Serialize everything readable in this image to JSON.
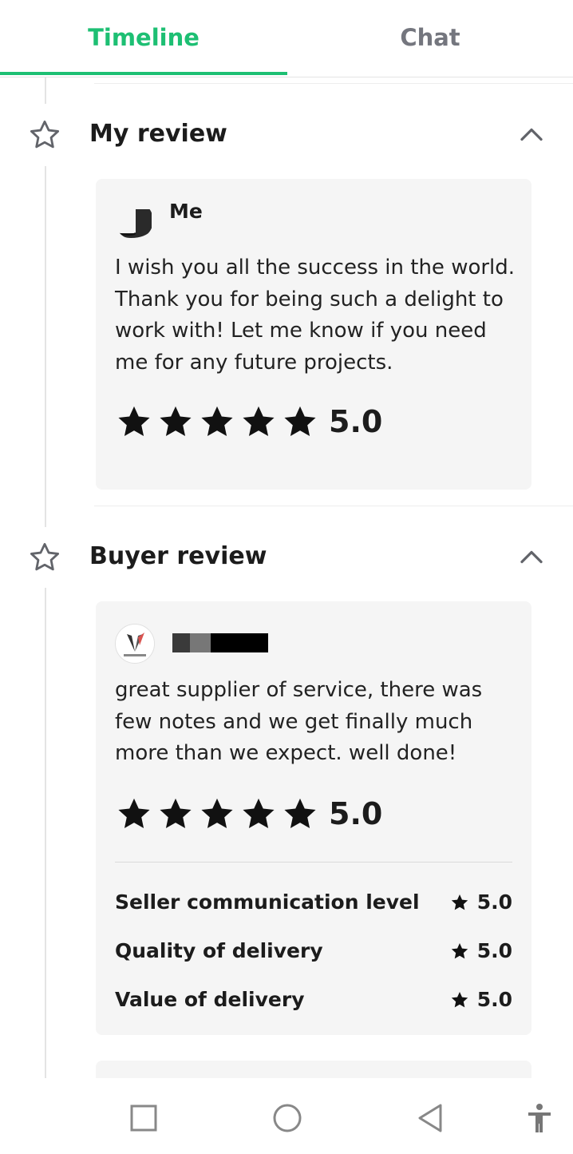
{
  "tabs": [
    {
      "label": "Timeline",
      "active": true
    },
    {
      "label": "Chat",
      "active": false
    }
  ],
  "colors": {
    "accent": "#1dbf73",
    "inactive_tab": "#74767e",
    "card_bg": "#f5f5f5"
  },
  "my_review": {
    "title": "My review",
    "author": "Me",
    "text": "I wish you all the success in the world. Thank you for being such a delight to work with! Let me know if you need me for any future projects.",
    "rating": "5.0",
    "stars": 5
  },
  "buyer_review": {
    "title": "Buyer review",
    "author": "",
    "text": "great supplier of service, there was few notes and we get finally much more than we expect. well done!",
    "rating": "5.0",
    "stars": 5,
    "sub_ratings": [
      {
        "label": "Seller communication level",
        "score": "5.0"
      },
      {
        "label": "Quality of delivery",
        "score": "5.0"
      },
      {
        "label": "Value of delivery",
        "score": "5.0"
      }
    ]
  },
  "icons": {
    "section": "star-outline-icon",
    "collapse": "chevron-up-icon",
    "nav": [
      "recent-apps-icon",
      "home-icon",
      "back-icon",
      "accessibility-icon"
    ]
  }
}
